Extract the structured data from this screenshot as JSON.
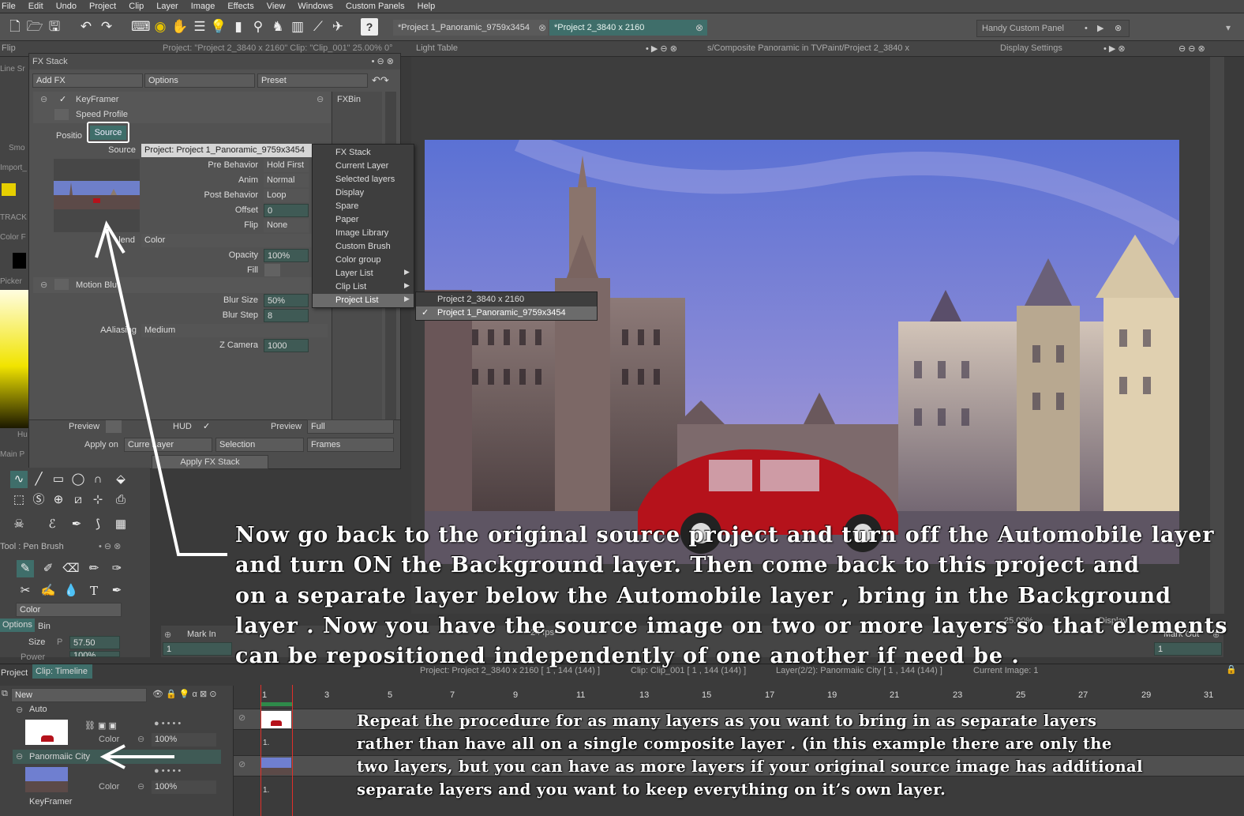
{
  "menu": [
    "File",
    "Edit",
    "Undo",
    "Project",
    "Clip",
    "Layer",
    "Image",
    "Effects",
    "View",
    "Windows",
    "Custom Panels",
    "Help"
  ],
  "tabs": {
    "project1": "*Project 1_Panoramic_9759x3454",
    "project2": "*Project 2_3840 x 2160",
    "handy_panel": "Handy Custom Panel"
  },
  "row2": {
    "flip": "Flip",
    "project_info": "Project: \"Project 2_3840 x 2160\"  Clip: \"Clip_001\"  25.00%  0°",
    "light_table": "Light Table",
    "path": "s/Composite Panoramic in TVPaint/Project 2_3840 x",
    "display_settings": "Display Settings"
  },
  "left_labels": [
    "Line Sr",
    "Smo",
    "Import_",
    "TRACK",
    "Color F",
    "Picker",
    "Hu",
    "Main P"
  ],
  "fx": {
    "title": "FX Stack",
    "add_fx": "Add FX",
    "options": "Options",
    "preset": "Preset",
    "keyframer": "KeyFramer",
    "fxbin": "FXBin",
    "speed_profile": "Speed Profile",
    "position_tab": "Positio",
    "source_tab": "Source",
    "source_label": "Source",
    "source_value": "Project: Project 1_Panoramic_9759x3454",
    "pre_behavior_label": "Pre Behavior",
    "pre_behavior_value": "Hold First",
    "anim_label": "Anim",
    "anim_value": "Normal",
    "post_behavior_label": "Post Behavior",
    "post_behavior_value": "Loop",
    "offset_label": "Offset",
    "offset_value": "0",
    "flip_label": "Flip",
    "flip_value": "None",
    "blend_label": "lend",
    "blend_value": "Color",
    "opacity_label": "Opacity",
    "opacity_value": "100%",
    "fill_label": "Fill",
    "motion_blur": "Motion Blu",
    "blur_size_label": "Blur Size",
    "blur_size_value": "50%",
    "blur_step_label": "Blur Step",
    "blur_step_value": "8",
    "aalias_label": "AAliasing",
    "aalias_value": "Medium",
    "zcam_label": "Z Camera",
    "zcam_value": "1000",
    "preview_label": "Preview",
    "hud_label": "HUD",
    "preview2_label": "Preview",
    "preview2_value": "Full",
    "apply_on_label": "Apply on",
    "apply_on_value": "Curre Layer",
    "selection": "Selection",
    "frames": "Frames",
    "apply_button": "Apply FX Stack"
  },
  "ctx_menu": [
    "FX Stack",
    "Current Layer",
    "Selected layers",
    "Display",
    "Spare",
    "Paper",
    "Image Library",
    "Custom Brush",
    "Color group",
    "Layer List",
    "Clip List",
    "Project List"
  ],
  "ctx_selected_index": 11,
  "submenu": [
    "Project 2_3840 x 2160",
    "Project 1_Panoramic_9759x3454"
  ],
  "submenu_checked_index": 1,
  "tool_panel": {
    "title": "Tool : Pen Brush",
    "color": "Color",
    "options_tab": "Options",
    "bin_tab": "Bin",
    "size_label": "Size",
    "size_p": "P",
    "size_value": "57.50",
    "power_label": "Power",
    "power_value": "100%"
  },
  "markers": {
    "mark_in": "Mark In",
    "mark_in_value": "1",
    "mark_out": "Mark Out",
    "mark_out_value": "1",
    "fps": "24 fps",
    "zoom": "25.00%",
    "display": "Display"
  },
  "timeline": {
    "project_tab": "Project",
    "clip_tab": "Clip: Timeline",
    "status_project": "Project: Project 2_3840 x 2160 [ 1 , 144  (144) ]",
    "status_clip": "Clip: Clip_001 [ 1 , 144  (144) ]",
    "status_layer": "Layer(2/2): Panormaiic City [ 1 , 144  (144) ]",
    "status_image": "Current Image: 1",
    "new_label": "New",
    "layer1_name": "Auto",
    "layer1_mode": "Color",
    "layer1_opacity": "100%",
    "layer2_name": "Panormaiic City",
    "layer2_mode": "Color",
    "layer2_opacity": "100%",
    "layer2_fx": "KeyFramer",
    "frame_numbers": [
      "1",
      "3",
      "5",
      "7",
      "9",
      "11",
      "13",
      "15",
      "17",
      "19",
      "21",
      "23",
      "25",
      "27",
      "29",
      "31"
    ],
    "track_first_frame": "1."
  },
  "annotations": {
    "main": [
      "Now go back to the original source project and turn off the Automobile layer",
      "and turn ON the Background layer.  Then come back to this project and",
      "on a separate layer below the Automobile layer , bring in the Background",
      "layer . Now you have the source image on two or more layers so that elements",
      "can be repositioned independently of one another if need be ."
    ],
    "secondary": [
      "Repeat the procedure for as many layers as you want to bring in as separate layers",
      "rather than have all on a single composite layer . (in this example there are only the",
      " two layers, but you can have as more layers if your original source image has additional",
      "separate layers and you want to keep everything on it’s own layer."
    ]
  },
  "colors": {
    "accent_tab": "#3f6e6a",
    "input_bg": "#3f5a55",
    "playhead": "#e0302a",
    "car_red": "#b5121b",
    "sky": "#6f7fd0"
  }
}
